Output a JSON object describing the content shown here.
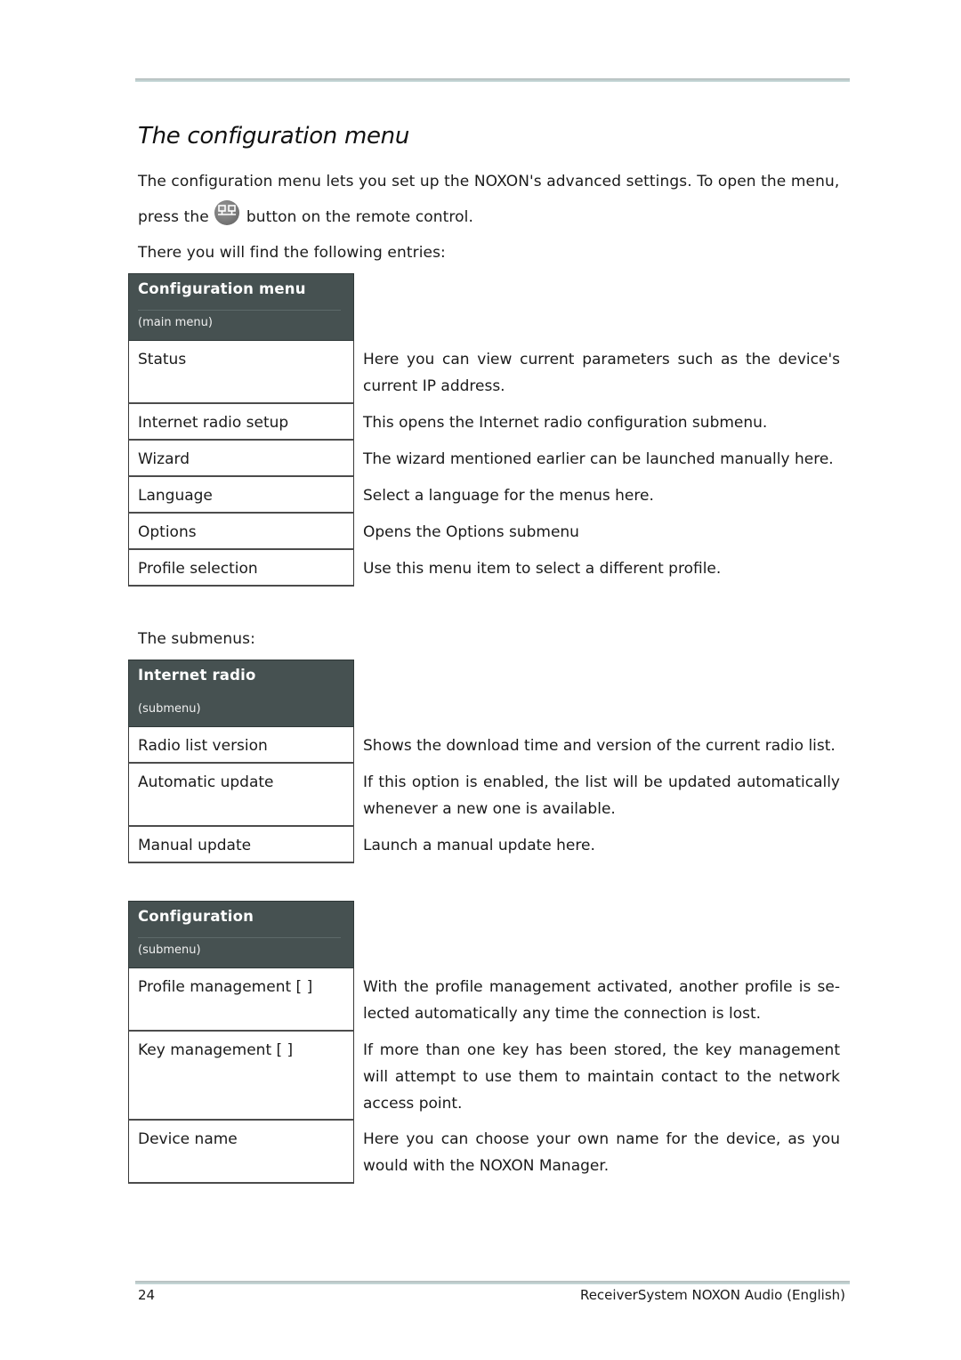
{
  "page": {
    "title": "The configuration menu",
    "intro": {
      "line1": "The configuration menu lets you set up the NOXON's advanced settings. To open the menu,",
      "line2_before_icon": "press the",
      "icon": "remote-menu-button-icon",
      "line2_after_icon": "button on the remote control."
    },
    "entries_intro": "There you will find the following entries:",
    "submenus_intro": "The submenus:"
  },
  "tables": [
    {
      "title": "Configuration menu",
      "subtitle": "(main menu)",
      "rows": [
        {
          "item": "Status",
          "desc": "Here you can view current parameters such as the device's current IP address."
        },
        {
          "item": "Internet radio setup",
          "desc": "This opens the Internet radio configuration submenu."
        },
        {
          "item": "Wizard",
          "desc": "The wizard mentioned earlier can be launched manually here."
        },
        {
          "item": "Language",
          "desc": "Select a language for the menus here."
        },
        {
          "item": "Options",
          "desc": "Opens the Options submenu"
        },
        {
          "item": "Profile selection",
          "desc": "Use this menu item to select a different profile."
        }
      ]
    },
    {
      "title": "Internet radio",
      "subtitle": "(submenu)",
      "rows": [
        {
          "item": "Radio list version",
          "desc": "Shows the download time and version of the current radio list."
        },
        {
          "item": "Automatic update",
          "desc": "If this option is enabled, the list will be updated automatically whenever a new one is available."
        },
        {
          "item": "Manual update",
          "desc": "Launch a manual update here."
        }
      ]
    },
    {
      "title": "Configuration",
      "subtitle": "(submenu)",
      "rows": [
        {
          "item": "Profile management [ ]",
          "desc": "With the profile management activated, another profile is se-lected automatically any time the connection is lost."
        },
        {
          "item": "Key management [ ]",
          "desc": "If more than one key has been stored, the key management will attempt to use them to maintain contact to the network access point."
        },
        {
          "item": "Device name",
          "desc": "Here you can choose your own name for the device, as you would with the NOXON Manager."
        }
      ]
    }
  ],
  "footer": {
    "page_number": "24",
    "document_title": "ReceiverSystem NOXON Audio (English)"
  },
  "colors": {
    "header_bg": "#465151",
    "rule": "#c9dcdc"
  }
}
